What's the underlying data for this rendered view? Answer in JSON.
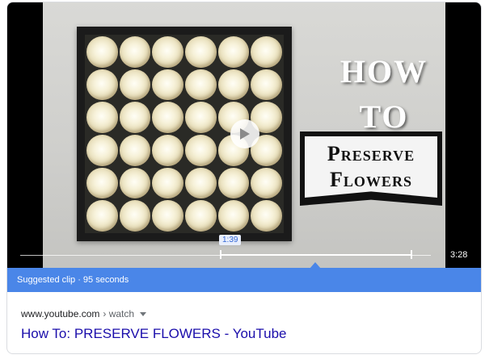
{
  "video": {
    "title_lines": [
      "HOW",
      "TO"
    ],
    "sign_lines": [
      "Preserve",
      "Flowers"
    ],
    "clip_start_time": "1:39",
    "duration": "3:28",
    "clip_start_fraction": 0.476,
    "clip_end_fraction": 0.95
  },
  "suggested_clip": {
    "label": "Suggested clip · 95 seconds",
    "bar_color": "#4a86e8"
  },
  "result": {
    "domain": "www.youtube.com",
    "path": "› watch",
    "title": "How To: PRESERVE FLOWERS - YouTube",
    "link_color": "#1a0dab"
  },
  "icons": {
    "play": "play-icon",
    "dropdown": "chevron-down-icon"
  }
}
